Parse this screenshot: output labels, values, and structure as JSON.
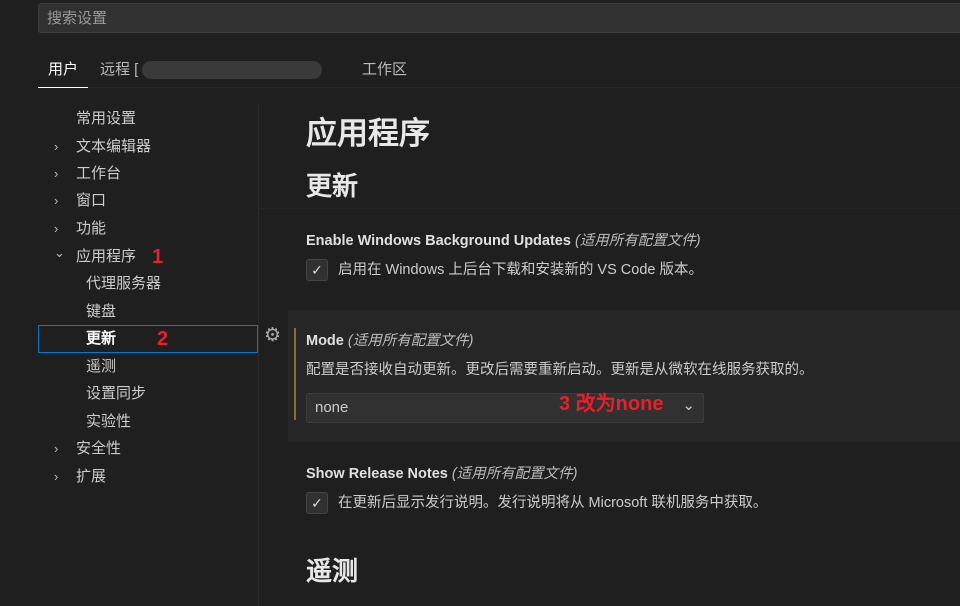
{
  "search": {
    "placeholder": "搜索设置"
  },
  "tabs": [
    {
      "label": "用户"
    },
    {
      "label": "远程 ["
    },
    {
      "label": "工作区"
    }
  ],
  "sidebar": {
    "items": [
      {
        "label": "常用设置",
        "chevron": ""
      },
      {
        "label": "文本编辑器",
        "chevron": "›"
      },
      {
        "label": "工作台",
        "chevron": "›"
      },
      {
        "label": "窗口",
        "chevron": "›"
      },
      {
        "label": "功能",
        "chevron": "›"
      },
      {
        "label": "应用程序",
        "chevron": "⌄"
      },
      {
        "label": "代理服务器"
      },
      {
        "label": "键盘"
      },
      {
        "label": "更新"
      },
      {
        "label": "遥测"
      },
      {
        "label": "设置同步"
      },
      {
        "label": "实验性"
      },
      {
        "label": "安全性",
        "chevron": "›"
      },
      {
        "label": "扩展",
        "chevron": "›"
      }
    ]
  },
  "annotations": {
    "a1": "1",
    "a2": "2",
    "a3": "3 改为none"
  },
  "main": {
    "heading": "应用程序",
    "section": "更新",
    "next_section": "遥测",
    "settings": [
      {
        "title": "Enable Windows Background Updates",
        "scope": "(适用所有配置文件)",
        "checked": true,
        "desc": "启用在 Windows 上后台下载和安装新的 VS Code 版本。"
      },
      {
        "title": "Mode",
        "scope": "(适用所有配置文件)",
        "desc": "配置是否接收自动更新。更改后需要重新启动。更新是从微软在线服务获取的。",
        "value": "none"
      },
      {
        "title": "Show Release Notes",
        "scope": "(适用所有配置文件)",
        "checked": true,
        "desc": "在更新后显示发行说明。发行说明将从 Microsoft 联机服务中获取。"
      }
    ]
  },
  "colors": {
    "accent": "#0078d4",
    "modified": "#8a6d2b",
    "annotation": "#e8202a"
  }
}
